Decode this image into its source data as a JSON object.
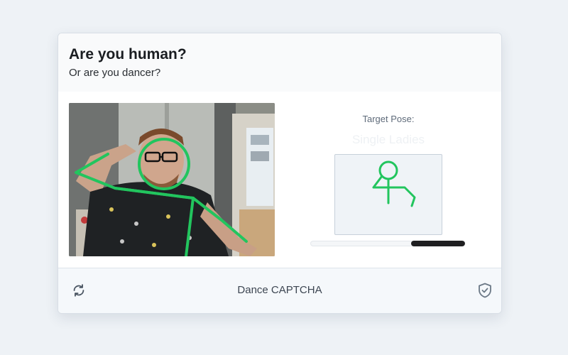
{
  "captcha": {
    "title": "Are you human?",
    "subtitle": "Or are you dancer?",
    "target_label": "Target Pose:",
    "pose_name": "Single Ladies",
    "progress": 0.35,
    "footer_label": "Dance CAPTCHA",
    "skeleton_color": "#22c55e"
  },
  "icons": {
    "refresh": "refresh-icon",
    "shield": "shield-check-icon"
  }
}
